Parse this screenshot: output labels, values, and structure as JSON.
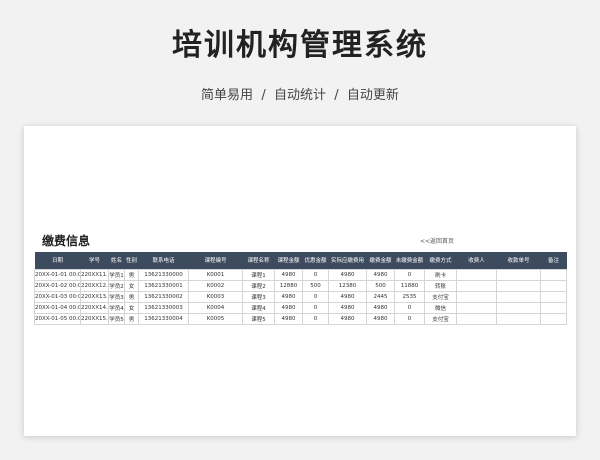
{
  "header": {
    "title": "培训机构管理系统",
    "subtitle_items": [
      "简单易用",
      "自动统计",
      "自动更新"
    ],
    "separator": "/"
  },
  "section": {
    "title": "缴费信息",
    "back_link": "<<返回首页"
  },
  "table": {
    "columns": [
      "日期",
      "学号",
      "姓名",
      "性别",
      "联系电话",
      "课程编号",
      "课程名称",
      "课程金额",
      "优惠金额",
      "实际应缴费用",
      "缴费金额",
      "未缴费金额",
      "缴费方式",
      "收费人",
      "收款单号",
      "备注"
    ],
    "rows": [
      [
        "20XX-01-01 00:00",
        "220XX11.0",
        "学员1",
        "男",
        "13621330000",
        "K0001",
        "课程1",
        "4980",
        "0",
        "4980",
        "4980",
        "0",
        "刷卡",
        "",
        "",
        ""
      ],
      [
        "20XX-01-02 00:00",
        "220XX12.0",
        "学员2",
        "女",
        "13621330001",
        "K0002",
        "课程2",
        "12880",
        "500",
        "12380",
        "500",
        "11880",
        "转账",
        "",
        "",
        ""
      ],
      [
        "20XX-01-03 00:00",
        "220XX13.0",
        "学员3",
        "男",
        "13621330002",
        "K0003",
        "课程3",
        "4980",
        "0",
        "4980",
        "2445",
        "2535",
        "支付宝",
        "",
        "",
        ""
      ],
      [
        "20XX-01-04 00:00",
        "220XX14.0",
        "学员4",
        "女",
        "13621330003",
        "K0004",
        "课程4",
        "4980",
        "0",
        "4980",
        "4980",
        "0",
        "微信",
        "",
        "",
        ""
      ],
      [
        "20XX-01-05 00:00",
        "220XX15.0",
        "学员5",
        "男",
        "13621330004",
        "K0005",
        "课程5",
        "4980",
        "0",
        "4980",
        "4980",
        "0",
        "支付宝",
        "",
        "",
        ""
      ]
    ]
  },
  "colors": {
    "header_bg": "#3d4b5e",
    "page_bg": "#f2f2f2",
    "card_bg": "#ffffff"
  }
}
